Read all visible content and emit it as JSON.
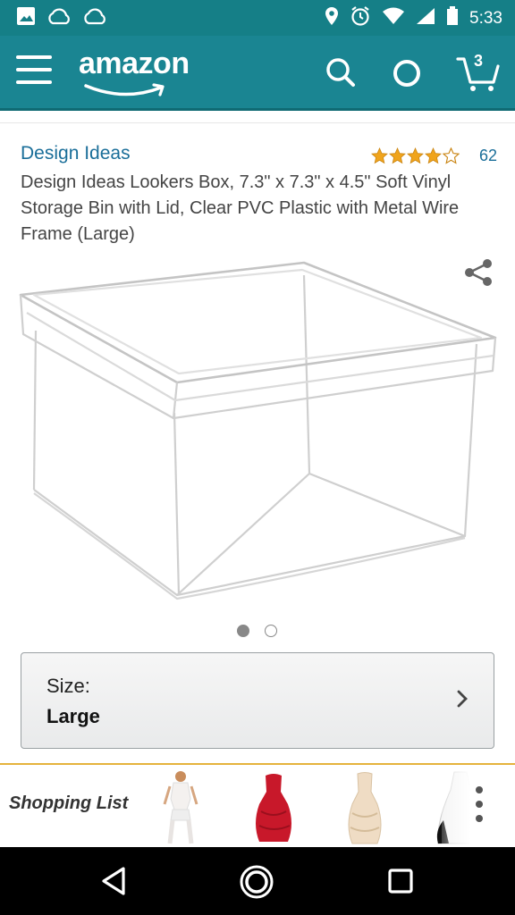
{
  "status_bar": {
    "time": "5:33",
    "icons": [
      "image-icon",
      "cloud-upload-icon",
      "cloud-icon",
      "location-icon",
      "alarm-icon",
      "wifi-icon",
      "signal-icon",
      "battery-icon"
    ]
  },
  "header": {
    "logo_text": "amazon",
    "cart_count": "3",
    "icons": [
      "menu-icon",
      "search-icon",
      "alexa-icon",
      "cart-icon"
    ]
  },
  "product": {
    "brand": "Design Ideas",
    "rating": 4.5,
    "review_count": "62",
    "title": "Design Ideas Lookers Box, 7.3\" x 7.3\" x 4.5\" Soft Vinyl Storage Bin with Lid, Clear PVC Plastic with Metal Wire Frame (Large)",
    "image_count": 2,
    "active_image": 0
  },
  "size_selector": {
    "label": "Size:",
    "value": "Large"
  },
  "shopping_list": {
    "label": "Shopping List",
    "items": [
      "white-lingerie-item",
      "red-dress-item",
      "cream-dress-item",
      "black-white-skirt-item"
    ]
  },
  "colors": {
    "header_teal": "#1a8592",
    "status_teal": "#157f87",
    "link_blue": "#1a6e99",
    "star_gold": "#f0a41c",
    "accent_gold": "#e5b33c"
  }
}
